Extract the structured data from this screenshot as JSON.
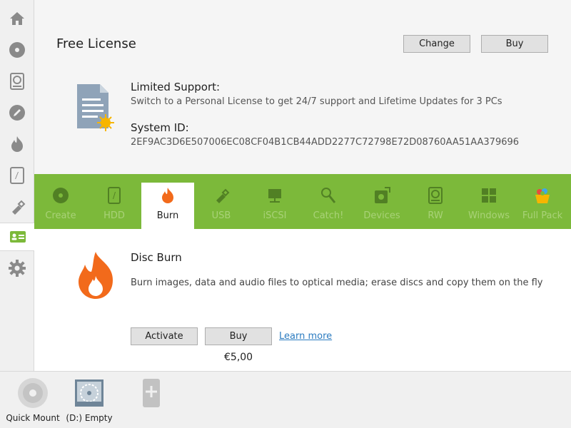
{
  "sidebar": {
    "items": [
      {
        "icon": "home-icon"
      },
      {
        "icon": "disc-icon"
      },
      {
        "icon": "hdd-icon"
      },
      {
        "icon": "edit-pen-icon"
      },
      {
        "icon": "burn-flame-icon"
      },
      {
        "icon": "catch-drive-icon"
      },
      {
        "icon": "usb-icon"
      },
      {
        "icon": "license-card-icon",
        "active": true
      },
      {
        "icon": "gear-icon"
      }
    ]
  },
  "license": {
    "title": "Free License",
    "change_label": "Change",
    "buy_label": "Buy",
    "support_heading": "Limited Support:",
    "support_text": "Switch to a Personal License to get 24/7 support and Lifetime Updates for 3 PCs",
    "system_id_heading": "System ID:",
    "system_id": "2EF9AC3D6E507006EC08CF04B1CB44ADD2277C72798E72D08760AA51AA379696"
  },
  "tabs": [
    {
      "label": "Create",
      "icon": "create-disc-icon"
    },
    {
      "label": "HDD",
      "icon": "hdd-tab-icon"
    },
    {
      "label": "Burn",
      "icon": "burn-tab-icon",
      "active": true
    },
    {
      "label": "USB",
      "icon": "usb-tab-icon"
    },
    {
      "label": "iSCSI",
      "icon": "iscsi-tab-icon"
    },
    {
      "label": "Catch!",
      "icon": "catch-tab-icon"
    },
    {
      "label": "Devices",
      "icon": "devices-tab-icon"
    },
    {
      "label": "RW",
      "icon": "rw-tab-icon"
    },
    {
      "label": "Windows",
      "icon": "windows-tab-icon"
    },
    {
      "label": "Full Pack",
      "icon": "full-pack-tab-icon"
    }
  ],
  "product": {
    "title": "Disc Burn",
    "description": "Burn images, data and audio files to optical media; erase discs and copy them on the fly",
    "activate_label": "Activate",
    "buy_label": "Buy",
    "learn_more": "Learn more",
    "price": "€5,00"
  },
  "bottom": {
    "items": [
      {
        "label": "Quick Mount",
        "icon": "quick-mount-disc-icon"
      },
      {
        "label": "(D:) Empty",
        "icon": "virtual-drive-icon"
      },
      {
        "label": "",
        "icon": "add-device-icon"
      }
    ]
  },
  "colors": {
    "accent_green": "#7cb93a",
    "flame_orange": "#f26a1b",
    "link_blue": "#2b7bc0"
  }
}
